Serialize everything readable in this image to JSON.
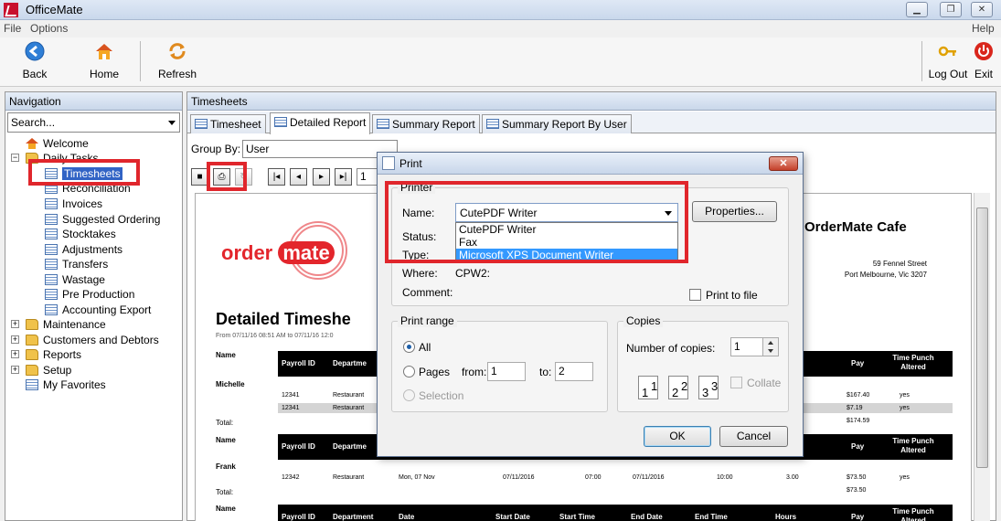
{
  "app": {
    "title": "OfficeMate"
  },
  "menu": {
    "file": "File",
    "options": "Options",
    "help": "Help"
  },
  "toolbar": {
    "back": "Back",
    "home": "Home",
    "refresh": "Refresh",
    "logout": "Log Out",
    "exit": "Exit"
  },
  "nav": {
    "header": "Navigation",
    "search_placeholder": "Search...",
    "items": {
      "welcome": "Welcome",
      "daily_tasks": "Daily Tasks",
      "timesheets": "Timesheets",
      "reconciliation": "Reconciliation",
      "invoices": "Invoices",
      "suggested_ordering": "Suggested Ordering",
      "stocktakes": "Stocktakes",
      "adjustments": "Adjustments",
      "transfers": "Transfers",
      "wastage": "Wastage",
      "pre_production": "Pre Production",
      "accounting_export": "Accounting Export",
      "maintenance": "Maintenance",
      "customers_debtors": "Customers and Debtors",
      "reports": "Reports",
      "setup": "Setup",
      "favorites": "My Favorites"
    }
  },
  "main": {
    "header": "Timesheets",
    "tabs": [
      "Timesheet",
      "Detailed Report",
      "Summary Report",
      "Summary Report By User"
    ],
    "group_by_label": "Group By:",
    "group_by_value": "User",
    "page_number": "1"
  },
  "report": {
    "logo_left": "order",
    "logo_right": "mate",
    "company": "OrderMate Cafe",
    "address1": "59 Fennel Street",
    "address2": "Port Melbourne, Vic 3207",
    "title": "Detailed Timeshe",
    "subtitle": "From 07/11/16 08:51 AM to 07/11/16 12:0",
    "name_label": "Name",
    "total_label": "Total:",
    "col_payroll": "Payroll ID",
    "col_dept_short": "Departme",
    "col_dept": "Department",
    "col_date": "Date",
    "col_start_date": "Start Date",
    "col_start_time": "Start Time",
    "col_end_date": "End Date",
    "col_end_time": "End Time",
    "col_hours": "Hours",
    "col_pay": "Pay",
    "col_punch_1": "Time Punch",
    "col_punch_2": "Altered",
    "michelle": {
      "name": "Michelle",
      "rows": [
        {
          "id": "12341",
          "dept": "Restaurant",
          "pay": "$167.40",
          "altered": "yes"
        },
        {
          "id": "12341",
          "dept": "Restaurant",
          "pay": "$7.19",
          "altered": "yes"
        }
      ],
      "total": "$174.59"
    },
    "frank": {
      "name": "Frank",
      "row": {
        "id": "12342",
        "dept": "Restaurant",
        "date": "Mon, 07 Nov",
        "start_date": "07/11/2016",
        "start_time": "07:00",
        "end_date": "07/11/2016",
        "end_time": "10:00",
        "hours": "3.00",
        "pay": "$73.50",
        "altered": "yes"
      },
      "total": "$73.50"
    }
  },
  "print_dialog": {
    "title": "Print",
    "printer_group": "Printer",
    "name_label": "Name:",
    "name_value": "CutePDF Writer",
    "printer_options": [
      "CutePDF Writer",
      "Fax",
      "Microsoft XPS Document Writer"
    ],
    "properties": "Properties...",
    "status_label": "Status:",
    "type_label": "Type:",
    "where_label": "Where:",
    "where_value": "CPW2:",
    "comment_label": "Comment:",
    "print_to_file": "Print to file",
    "range_group": "Print range",
    "all": "All",
    "pages": "Pages",
    "from_label": "from:",
    "from_value": "1",
    "to_label": "to:",
    "to_value": "2",
    "selection": "Selection",
    "copies_group": "Copies",
    "copies_label": "Number of copies:",
    "copies_value": "1",
    "collate": "Collate",
    "collate_pages": [
      "1",
      "1",
      "2",
      "2",
      "3",
      "3"
    ],
    "ok": "OK",
    "cancel": "Cancel"
  },
  "colors": {
    "accent": "#e0262c",
    "selection": "#3163c5",
    "highlight": "#3399ff"
  }
}
